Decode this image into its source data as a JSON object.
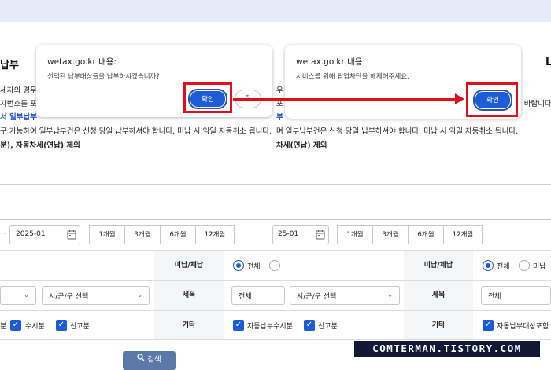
{
  "page": {
    "heading_left": "납부",
    "heading_right": "L",
    "notice_lines_left": [
      "세자의 경우,",
      "자번호를 포",
      "서 일부납부",
      "구 가능하여 일부납부건은 신청 당일 납부하셔야 합니다. 미납 시 익일 자동취소 됩니다.",
      "분), 자동차세(연납) 제외"
    ],
    "notice_lines_right": [
      "우",
      "포",
      "] 바랍니다",
      "부",
      "며 일부납부건은 신청 당일 납부하셔야 합니다. 미납 시 익일 자동취소 됩니다.",
      "차세(연납) 제외"
    ]
  },
  "dialog_left": {
    "title": "wetax.go.kr 내용:",
    "message": "선택된 납부대상들을 납부하시겠습니까?",
    "ok_label": "확인",
    "cancel_label": "취"
  },
  "dialog_right": {
    "title": "wetax.go.kr 내용:",
    "message": "서비스를 위해 팝업차단을 해제해주세요.",
    "ok_label": "확인"
  },
  "filter_left": {
    "date_sep": "-",
    "date_value": "2025-01",
    "periods": [
      "1개월",
      "3개월",
      "6개월",
      "12개월"
    ],
    "row1_label": "미납/체납",
    "radio_all": "전체",
    "row2_label": "세목",
    "select_region": "시/군/구 선택",
    "tax_item_value": "전체",
    "row3_label": "기타",
    "checks_left": [
      "분",
      "수시분",
      "신고분"
    ],
    "checks_right": [
      "자동납부수시분",
      "신고분"
    ],
    "search_label": "검색"
  },
  "filter_right": {
    "date_value": "25-01",
    "periods": [
      "1개월",
      "3개월",
      "6개월",
      "12개월"
    ],
    "row1_label": "미납/체납",
    "radio_all": "전체",
    "radio_unpaid": "미납",
    "row2_label": "세목",
    "select_region": "시/군/구 선택",
    "tax_item_value": "전체",
    "row3_label": "기타",
    "check_right": "자동납부대상포함"
  },
  "watermark": "COMTERMAN.TISTORY.COM",
  "colors": {
    "accent": "#1d5bd8",
    "highlight": "#e0101a",
    "topbar": "#e6ebf9"
  },
  "icons": {
    "calendar": "calendar-icon",
    "chevron": "chevron-down-icon",
    "search": "search-icon"
  }
}
